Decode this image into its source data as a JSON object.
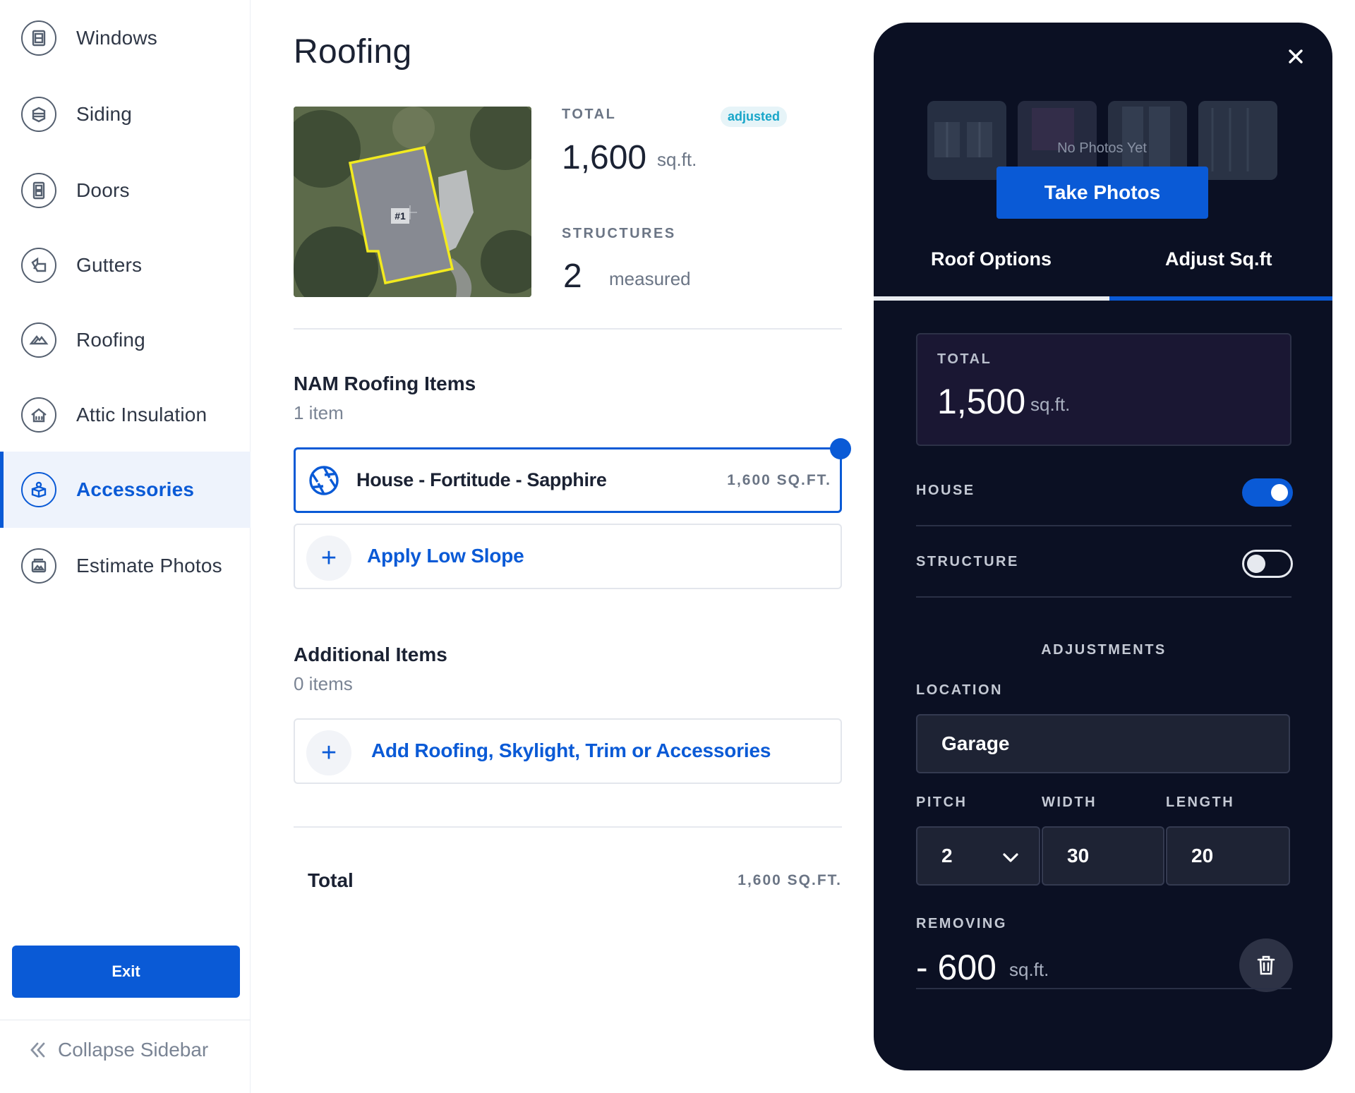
{
  "sidebar": {
    "items": [
      {
        "label": "Windows",
        "icon": "window-icon"
      },
      {
        "label": "Siding",
        "icon": "siding-icon"
      },
      {
        "label": "Doors",
        "icon": "door-icon"
      },
      {
        "label": "Gutters",
        "icon": "gutter-icon"
      },
      {
        "label": "Roofing",
        "icon": "roof-icon"
      },
      {
        "label": "Attic Insulation",
        "icon": "attic-insulation-icon"
      },
      {
        "label": "Accessories",
        "icon": "accessories-icon",
        "active": true
      },
      {
        "label": "Estimate Photos",
        "icon": "photo-icon"
      }
    ],
    "exit_label": "Exit",
    "collapse_label": "Collapse Sidebar"
  },
  "main": {
    "title": "Roofing",
    "map": {
      "structure_tag": "#1"
    },
    "total": {
      "label": "TOTAL",
      "badge": "adjusted",
      "value": "1,600",
      "unit": "sq.ft."
    },
    "structures": {
      "label": "STRUCTURES",
      "value": "2",
      "unit": "measured"
    },
    "nam_section": {
      "title": "NAM Roofing Items",
      "count": "1 item",
      "items": [
        {
          "name": "House - Fortitude - Sapphire",
          "size": "1,600 SQ.FT."
        }
      ],
      "action_label": "Apply Low Slope"
    },
    "additional_section": {
      "title": "Additional Items",
      "count": "0 items",
      "action_label": "Add Roofing, Skylight, Trim or Accessories"
    },
    "footer": {
      "label": "Total",
      "value": "1,600 SQ.FT."
    }
  },
  "panel": {
    "no_photos": "No Photos Yet",
    "take_photos_label": "Take Photos",
    "tabs": [
      {
        "label": "Roof Options",
        "active": false
      },
      {
        "label": "Adjust Sq.ft",
        "active": true
      }
    ],
    "total": {
      "label": "TOTAL",
      "value": "1,500",
      "unit": "sq.ft."
    },
    "house": {
      "label": "HOUSE",
      "enabled": true
    },
    "structure": {
      "label": "STRUCTURE",
      "enabled": false
    },
    "adjustments_heading": "ADJUSTMENTS",
    "location": {
      "label": "LOCATION",
      "value": "Garage"
    },
    "pitch": {
      "label": "PITCH",
      "value": "2"
    },
    "width": {
      "label": "WIDTH",
      "value": "30"
    },
    "length": {
      "label": "LENGTH",
      "value": "20"
    },
    "removing": {
      "label": "REMOVING",
      "value": "- 600",
      "unit": "sq.ft."
    }
  },
  "colors": {
    "accent": "#0a5ad6",
    "panel_bg": "#0b1023",
    "badge_text": "#18a6c9",
    "muted_text": "#6b7585"
  }
}
